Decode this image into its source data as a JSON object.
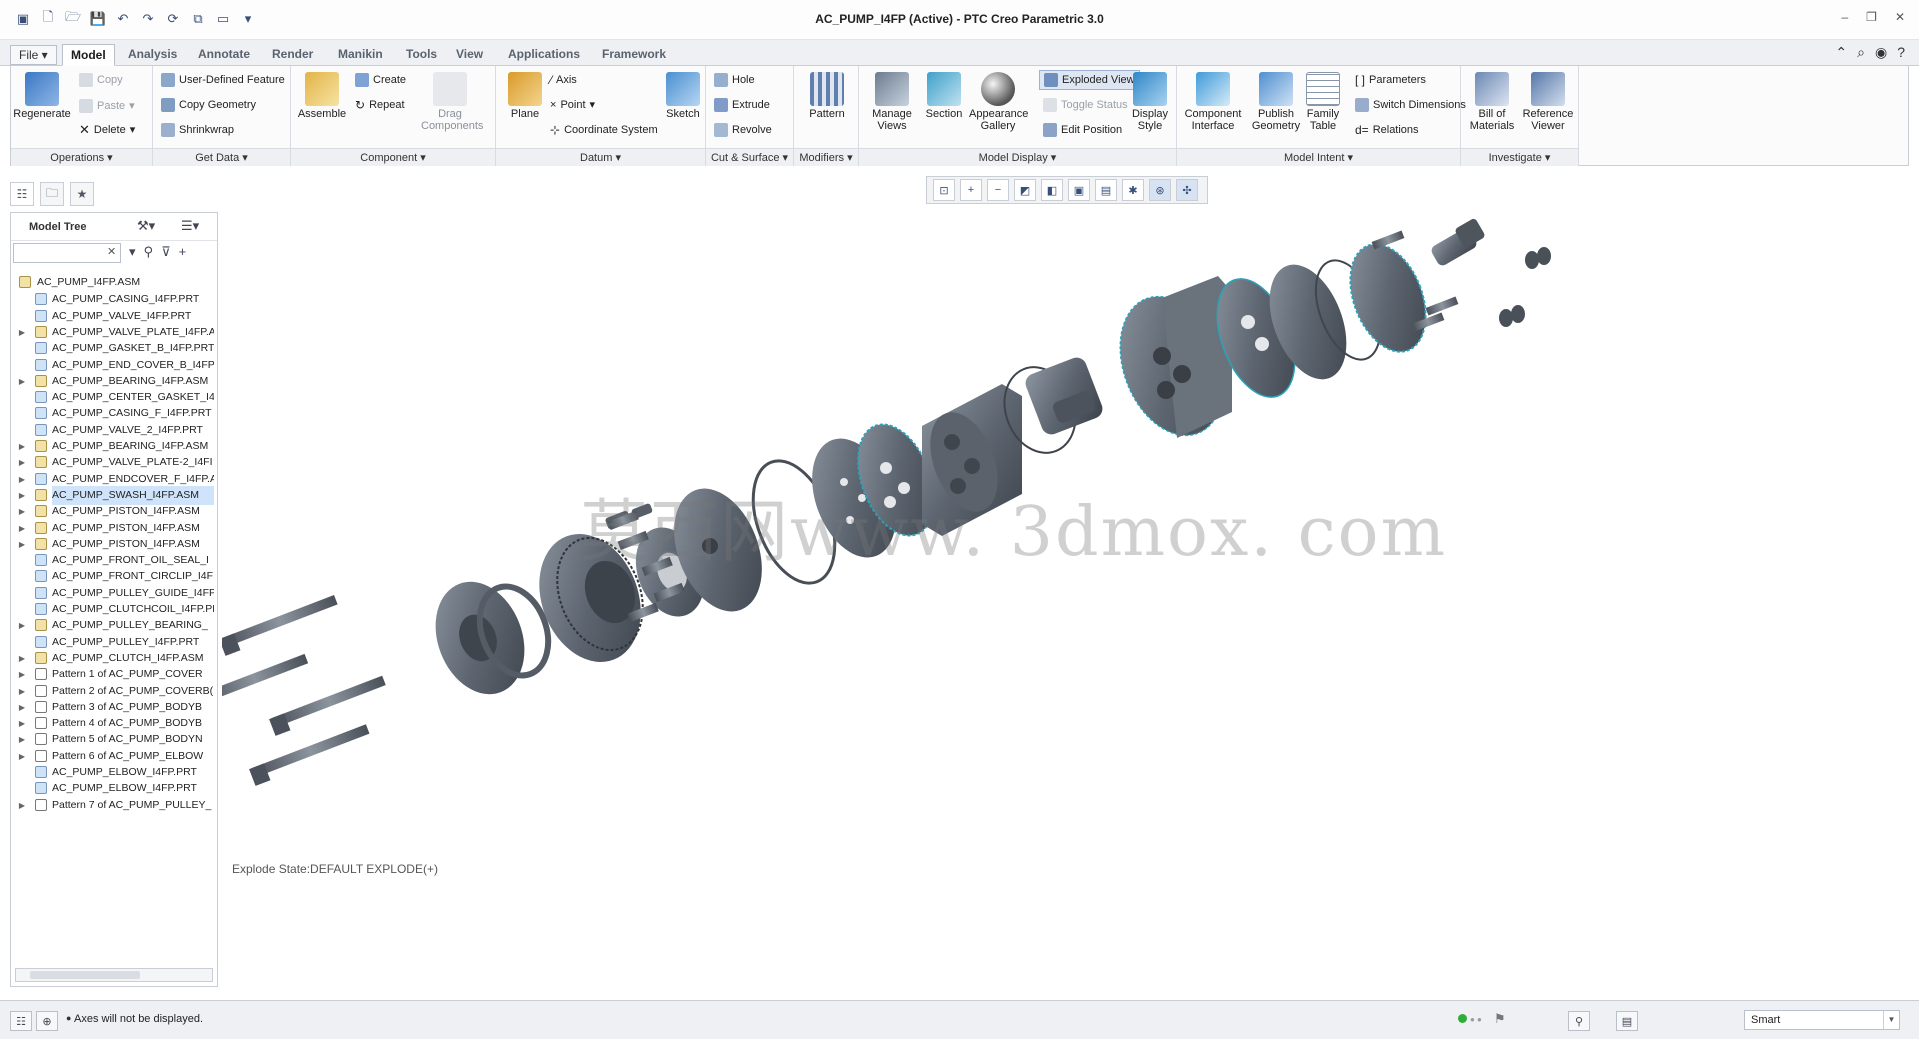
{
  "window": {
    "title": "AC_PUMP_I4FP (Active) - PTC Creo Parametric 3.0"
  },
  "tabs": [
    {
      "label": "File",
      "active": false
    },
    {
      "label": "Model",
      "active": true
    },
    {
      "label": "Analysis",
      "active": false
    },
    {
      "label": "Annotate",
      "active": false
    },
    {
      "label": "Render",
      "active": false
    },
    {
      "label": "Manikin",
      "active": false
    },
    {
      "label": "Tools",
      "active": false
    },
    {
      "label": "View",
      "active": false
    },
    {
      "label": "Applications",
      "active": false
    },
    {
      "label": "Framework",
      "active": false
    }
  ],
  "ribbon": {
    "operations": {
      "group": "Operations",
      "regenerate": "Regenerate",
      "copy": "Copy",
      "paste": "Paste",
      "delete": "Delete"
    },
    "get_data": {
      "group": "Get Data",
      "user_defined_feature": "User-Defined Feature",
      "copy_geometry": "Copy Geometry",
      "shrinkwrap": "Shrinkwrap"
    },
    "component": {
      "group": "Component",
      "assemble": "Assemble",
      "create": "Create",
      "repeat": "Repeat",
      "drag_components": "Drag Components"
    },
    "datum": {
      "group": "Datum",
      "plane": "Plane",
      "axis": "Axis",
      "point": "Point",
      "coordinate_system": "Coordinate System",
      "sketch": "Sketch"
    },
    "cut_surface": {
      "group": "Cut & Surface",
      "hole": "Hole",
      "extrude": "Extrude",
      "revolve": "Revolve"
    },
    "modifiers": {
      "group": "Modifiers",
      "pattern": "Pattern"
    },
    "model_display": {
      "group": "Model Display",
      "manage_views": "Manage Views",
      "section": "Section",
      "appearance_gallery": "Appearance Gallery",
      "exploded_view": "Exploded View",
      "toggle_status": "Toggle Status",
      "edit_position": "Edit Position",
      "display_style": "Display Style"
    },
    "model_intent": {
      "group": "Model Intent",
      "component_interface": "Component Interface",
      "publish_geometry": "Publish Geometry",
      "family_table": "Family Table",
      "parameters": "Parameters",
      "switch_dimensions": "Switch Dimensions",
      "relations": "Relations"
    },
    "investigate": {
      "group": "Investigate",
      "bill_of_materials": "Bill of Materials",
      "reference_viewer": "Reference Viewer"
    }
  },
  "model_tree": {
    "title": "Model Tree",
    "search_value": "",
    "root": "AC_PUMP_I4FP.ASM",
    "items": [
      {
        "label": "AC_PUMP_CASING_I4FP.PRT",
        "kind": "prt",
        "expandable": false,
        "selected": false
      },
      {
        "label": "AC_PUMP_VALVE_I4FP.PRT",
        "kind": "prt",
        "expandable": false,
        "selected": false
      },
      {
        "label": "AC_PUMP_VALVE_PLATE_I4FP.A",
        "kind": "asm",
        "expandable": true,
        "selected": false
      },
      {
        "label": "AC_PUMP_GASKET_B_I4FP.PRT",
        "kind": "prt",
        "expandable": false,
        "selected": false
      },
      {
        "label": "AC_PUMP_END_COVER_B_I4FP.",
        "kind": "prt",
        "expandable": false,
        "selected": false
      },
      {
        "label": "AC_PUMP_BEARING_I4FP.ASM",
        "kind": "asm",
        "expandable": true,
        "selected": false
      },
      {
        "label": "AC_PUMP_CENTER_GASKET_I4I",
        "kind": "prt",
        "expandable": false,
        "selected": false
      },
      {
        "label": "AC_PUMP_CASING_F_I4FP.PRT",
        "kind": "prt",
        "expandable": false,
        "selected": false
      },
      {
        "label": "AC_PUMP_VALVE_2_I4FP.PRT",
        "kind": "prt",
        "expandable": false,
        "selected": false
      },
      {
        "label": "AC_PUMP_BEARING_I4FP.ASM",
        "kind": "asm",
        "expandable": true,
        "selected": false
      },
      {
        "label": "AC_PUMP_VALVE_PLATE-2_I4FI",
        "kind": "asm",
        "expandable": true,
        "selected": false
      },
      {
        "label": "AC_PUMP_ENDCOVER_F_I4FP.A",
        "kind": "prt",
        "expandable": true,
        "selected": false
      },
      {
        "label": "AC_PUMP_SWASH_I4FP.ASM",
        "kind": "asm",
        "expandable": true,
        "selected": true
      },
      {
        "label": "AC_PUMP_PISTON_I4FP.ASM",
        "kind": "asm",
        "expandable": true,
        "selected": false
      },
      {
        "label": "AC_PUMP_PISTON_I4FP.ASM",
        "kind": "asm",
        "expandable": true,
        "selected": false
      },
      {
        "label": "AC_PUMP_PISTON_I4FP.ASM",
        "kind": "asm",
        "expandable": true,
        "selected": false
      },
      {
        "label": "AC_PUMP_FRONT_OIL_SEAL_I",
        "kind": "prt",
        "expandable": false,
        "selected": false
      },
      {
        "label": "AC_PUMP_FRONT_CIRCLIP_I4F",
        "kind": "prt",
        "expandable": false,
        "selected": false
      },
      {
        "label": "AC_PUMP_PULLEY_GUIDE_I4FP.",
        "kind": "prt",
        "expandable": false,
        "selected": false
      },
      {
        "label": "AC_PUMP_CLUTCHCOIL_I4FP.PR",
        "kind": "prt",
        "expandable": false,
        "selected": false
      },
      {
        "label": "AC_PUMP_PULLEY_BEARING_",
        "kind": "asm",
        "expandable": true,
        "selected": false
      },
      {
        "label": "AC_PUMP_PULLEY_I4FP.PRT",
        "kind": "prt",
        "expandable": false,
        "selected": false
      },
      {
        "label": "AC_PUMP_CLUTCH_I4FP.ASM",
        "kind": "asm",
        "expandable": true,
        "selected": false
      },
      {
        "label": "Pattern 1 of AC_PUMP_COVER",
        "kind": "pat",
        "expandable": true,
        "selected": false
      },
      {
        "label": "Pattern 2 of AC_PUMP_COVERB(",
        "kind": "pat",
        "expandable": true,
        "selected": false
      },
      {
        "label": "Pattern 3 of AC_PUMP_BODYB",
        "kind": "pat",
        "expandable": true,
        "selected": false
      },
      {
        "label": "Pattern 4 of AC_PUMP_BODYB",
        "kind": "pat",
        "expandable": true,
        "selected": false
      },
      {
        "label": "Pattern 5 of AC_PUMP_BODYN",
        "kind": "pat",
        "expandable": true,
        "selected": false
      },
      {
        "label": "Pattern 6 of AC_PUMP_ELBOW",
        "kind": "pat",
        "expandable": true,
        "selected": false
      },
      {
        "label": "AC_PUMP_ELBOW_I4FP.PRT",
        "kind": "prt",
        "expandable": false,
        "selected": false
      },
      {
        "label": "AC_PUMP_ELBOW_I4FP.PRT",
        "kind": "prt",
        "expandable": false,
        "selected": false
      },
      {
        "label": "Pattern 7 of AC_PUMP_PULLEY_",
        "kind": "pat",
        "expandable": true,
        "selected": false
      }
    ]
  },
  "graphics": {
    "watermark": "莫西网www. 3dmox. com",
    "explode_state": "Explode State:DEFAULT EXPLODE(+)"
  },
  "status": {
    "message": "Axes will not be displayed.",
    "filter_value": "Smart"
  },
  "colors": {
    "accent": "#1f5fa8",
    "part_gray": "#5d6570",
    "highlight_teal": "#2aa3b8"
  }
}
